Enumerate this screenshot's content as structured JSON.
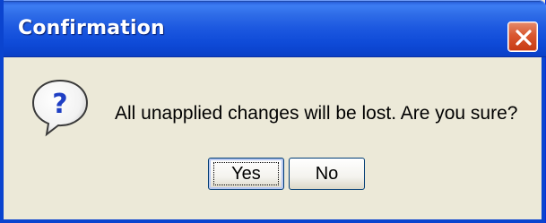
{
  "window": {
    "title": "Confirmation",
    "close_icon": "close-icon"
  },
  "dialog": {
    "icon": "question-icon",
    "message": "All unapplied changes will be lost.  Are you sure?"
  },
  "buttons": {
    "yes_label": "Yes",
    "no_label": "No",
    "default": "Yes"
  },
  "colors": {
    "titlebar": "#0b44cf",
    "client_background": "#ece9d8",
    "close_button": "#d9572f"
  }
}
